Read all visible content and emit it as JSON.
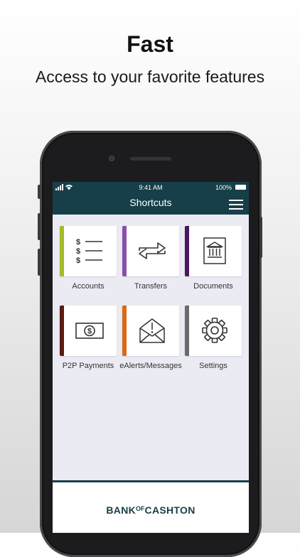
{
  "promo": {
    "title": "Fast",
    "subtitle": "Access to your favorite features"
  },
  "status_bar": {
    "time": "9:41 AM",
    "battery": "100%"
  },
  "header": {
    "title": "Shortcuts",
    "menu_icon": "hamburger-menu-icon"
  },
  "shortcuts": [
    {
      "label": "Accounts",
      "icon": "accounts-list-icon",
      "accent": "#a4bc2c"
    },
    {
      "label": "Transfers",
      "icon": "transfer-arrows-icon",
      "accent": "#8a4faa"
    },
    {
      "label": "Documents",
      "icon": "bank-building-icon",
      "accent": "#4a1763"
    },
    {
      "label": "P2P Payments",
      "icon": "money-bill-icon",
      "accent": "#5e1a12"
    },
    {
      "label": "eAlerts/Messages",
      "icon": "alert-envelope-icon",
      "accent": "#d96a17"
    },
    {
      "label": "Settings",
      "icon": "gear-icon",
      "accent": "#6b6b6b"
    }
  ],
  "footer": {
    "logo_left": "BANK",
    "logo_of": "OF",
    "logo_right": "CASHTON"
  },
  "colors": {
    "brand_dark_teal": "#173f49",
    "screen_background": "#ebebf3"
  }
}
